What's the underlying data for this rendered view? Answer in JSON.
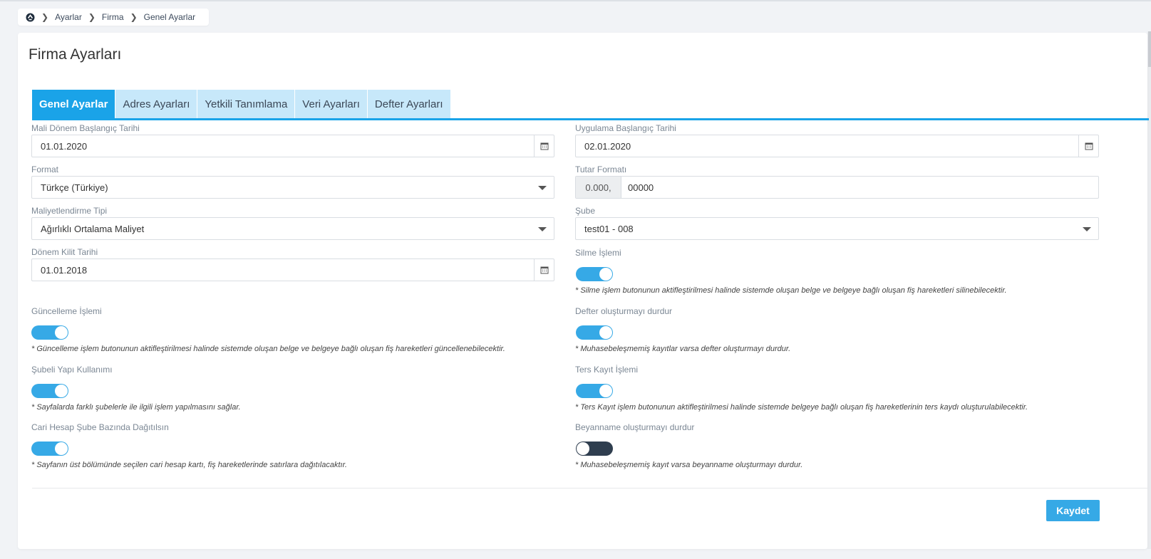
{
  "breadcrumb": {
    "items": [
      "Ayarlar",
      "Firma",
      "Genel Ayarlar"
    ]
  },
  "page_title": "Firma Ayarları",
  "tabs": [
    {
      "label": "Genel Ayarlar",
      "active": true
    },
    {
      "label": "Adres Ayarları",
      "active": false
    },
    {
      "label": "Yetkili Tanımlama",
      "active": false
    },
    {
      "label": "Veri Ayarları",
      "active": false
    },
    {
      "label": "Defter Ayarları",
      "active": false
    }
  ],
  "fields": {
    "mali_donem": {
      "label": "Mali Dönem Başlangıç Tarihi",
      "value": "01.01.2020"
    },
    "uygulama_baslangic": {
      "label": "Uygulama Başlangıç Tarihi",
      "value": "02.01.2020"
    },
    "format": {
      "label": "Format",
      "value": "Türkçe (Türkiye)"
    },
    "tutar_formati": {
      "label": "Tutar Formatı",
      "prefix": "0.000,",
      "value": "00000"
    },
    "maliyetlendirme": {
      "label": "Maliyetlendirme Tipi",
      "value": "Ağırlıklı Ortalama Maliyet"
    },
    "sube": {
      "label": "Şube",
      "value": "test01 - 008"
    },
    "donem_kilit": {
      "label": "Dönem Kilit Tarihi",
      "value": "01.01.2018"
    }
  },
  "toggles": {
    "silme": {
      "label": "Silme İşlemi",
      "on": true,
      "note": "* Silme işlem butonunun aktifleştirilmesi halinde sistemde oluşan belge ve belgeye bağlı oluşan fiş hareketleri silinebilecektir."
    },
    "guncelleme": {
      "label": "Güncelleme İşlemi",
      "on": true,
      "note": "* Güncelleme işlem butonunun aktifleştirilmesi halinde sistemde oluşan belge ve belgeye bağlı oluşan fiş hareketleri güncellenebilecektir."
    },
    "defter": {
      "label": "Defter oluşturmayı durdur",
      "on": true,
      "note": "* Muhasebeleşmemiş kayıtlar varsa defter oluşturmayı durdur."
    },
    "subeli": {
      "label": "Şubeli Yapı Kullanımı",
      "on": true,
      "note": "* Sayfalarda farklı şubelerle ile ilgili işlem yapılmasını sağlar."
    },
    "ters_kayit": {
      "label": "Ters Kayıt İşlemi",
      "on": true,
      "note": "* Ters Kayıt işlem butonunun aktifleştirilmesi halinde sistemde belgeye bağlı oluşan fiş hareketlerinin ters kaydı oluşturulabilecektir."
    },
    "cari_hesap": {
      "label": "Cari Hesap Şube Bazında Dağıtılsın",
      "on": true,
      "note": "* Sayfanın üst bölümünde seçilen cari hesap kartı, fiş hareketlerinde satırlara dağıtılacaktır."
    },
    "beyanname": {
      "label": "Beyanname oluşturmayı durdur",
      "on": false,
      "note": "* Muhasebeleşmemiş kayıt varsa beyanname oluşturmayı durdur."
    }
  },
  "save_label": "Kaydet",
  "colors": {
    "accent": "#1aa3e8",
    "tab_inactive": "#c7e8fa",
    "toggle_on": "#36a9e6",
    "toggle_off": "#2f3e4f"
  }
}
